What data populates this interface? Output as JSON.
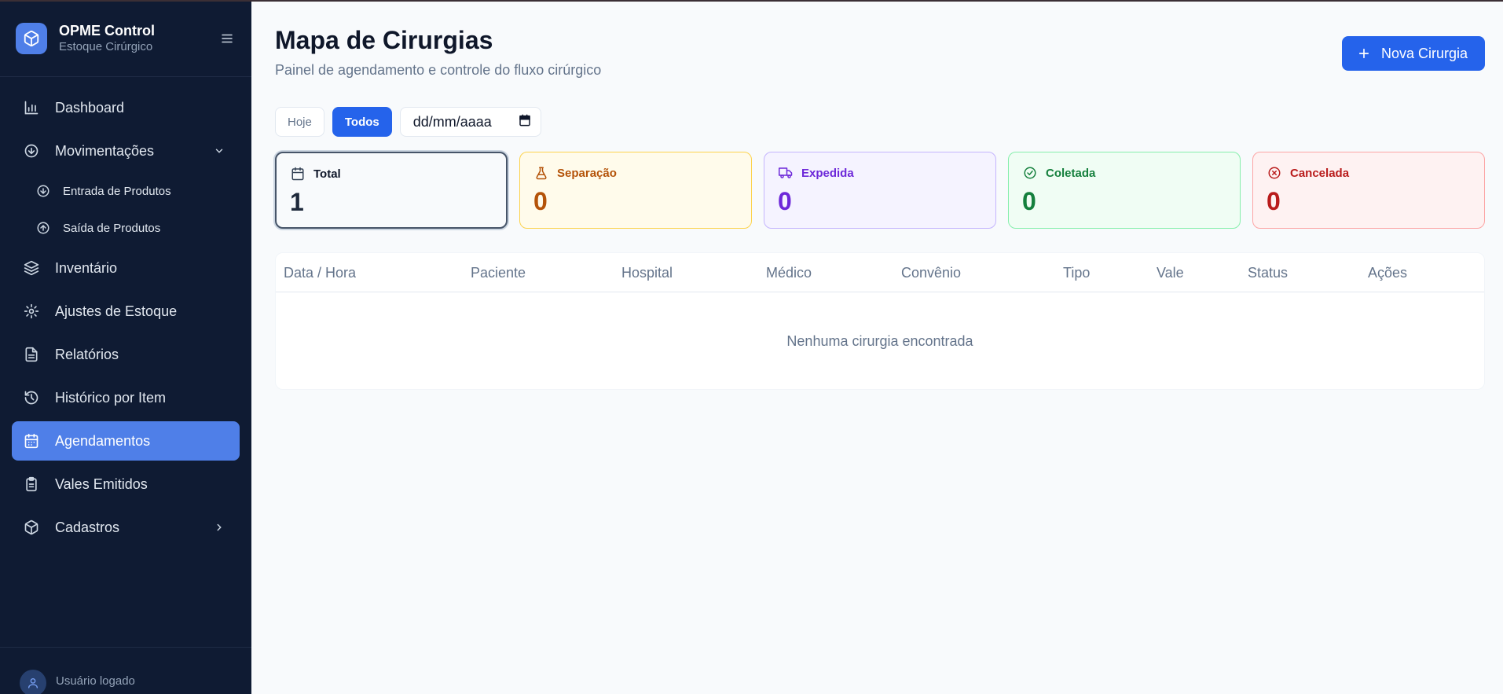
{
  "brand": {
    "title": "OPME Control",
    "subtitle": "Estoque Cirúrgico"
  },
  "sidebar": {
    "items": [
      {
        "label": "Dashboard",
        "icon": "bar-chart-icon"
      },
      {
        "label": "Movimentações",
        "icon": "arrow-down-circle-icon",
        "expanded": true,
        "children": [
          {
            "label": "Entrada de Produtos",
            "icon": "arrow-down-circle-icon"
          },
          {
            "label": "Saída de Produtos",
            "icon": "arrow-up-circle-icon"
          }
        ]
      },
      {
        "label": "Inventário",
        "icon": "layers-icon"
      },
      {
        "label": "Ajustes de Estoque",
        "icon": "gear-icon"
      },
      {
        "label": "Relatórios",
        "icon": "file-text-icon"
      },
      {
        "label": "Histórico por Item",
        "icon": "history-icon"
      },
      {
        "label": "Agendamentos",
        "icon": "calendar-icon",
        "active": true
      },
      {
        "label": "Vales Emitidos",
        "icon": "clipboard-icon"
      },
      {
        "label": "Cadastros",
        "icon": "box-icon",
        "expanded": false
      }
    ],
    "user_label": "Usuário logado"
  },
  "header": {
    "title": "Mapa de Cirurgias",
    "subtitle": "Painel de agendamento e controle do fluxo cirúrgico",
    "new_button": "Nova Cirurgia"
  },
  "filters": {
    "today": "Hoje",
    "all": "Todos",
    "active": "Todos",
    "date_placeholder": "dd/mm/aaaa"
  },
  "stats": [
    {
      "label": "Total",
      "value": "1",
      "icon": "calendar-icon",
      "color": "#1e293b"
    },
    {
      "label": "Separação",
      "value": "0",
      "icon": "flask-icon",
      "color": "#b45309"
    },
    {
      "label": "Expedida",
      "value": "0",
      "icon": "truck-icon",
      "color": "#6d28d9"
    },
    {
      "label": "Coletada",
      "value": "0",
      "icon": "check-circle-icon",
      "color": "#15803d"
    },
    {
      "label": "Cancelada",
      "value": "0",
      "icon": "x-circle-icon",
      "color": "#b91c1c"
    }
  ],
  "table": {
    "columns": [
      "Data / Hora",
      "Paciente",
      "Hospital",
      "Médico",
      "Convênio",
      "Tipo",
      "Vale",
      "Status",
      "Ações"
    ],
    "rows": [],
    "empty_message": "Nenhuma cirurgia encontrada"
  },
  "colors": {
    "sidebar_bg": "#0f1b33",
    "accent": "#2563eb",
    "active_nav": "#4f7fe8",
    "page_bg": "#f8fafc"
  }
}
